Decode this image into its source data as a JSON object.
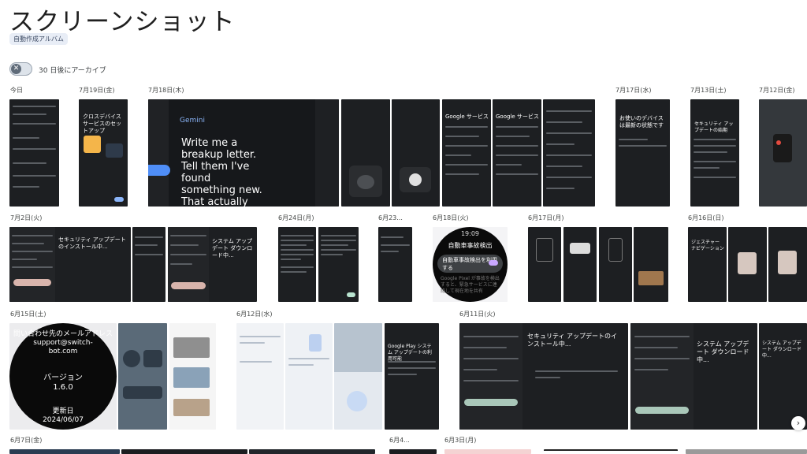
{
  "page": {
    "title": "スクリーンショット",
    "album_chip": "自動作成アルバム",
    "archive_toggle_label": "30 日後にアーカイブ",
    "archive_toggle_state": "off"
  },
  "dates": {
    "d_today": "今日",
    "d_0719": "7月19日(金)",
    "d_0718": "7月18日(木)",
    "d_0717": "7月17日(水)",
    "d_0713": "7月13日(土)",
    "d_0712": "7月12日(金)",
    "d_0702": "7月2日(火)",
    "d_0624": "6月24日(月)",
    "d_0623": "6月23...",
    "d_0618": "6月18日(火)",
    "d_0617": "6月17日(月)",
    "d_0616": "6月16日(日)",
    "d_0615": "6月15日(土)",
    "d_0612": "6月12日(水)",
    "d_0611": "6月11日(火)",
    "d_0607": "6月7日(金)",
    "d_0604": "6月4...",
    "d_0603": "6月3日(月)"
  },
  "tiles": {
    "gemini": {
      "logo": "Gemini",
      "text": "Write me a breakup letter. Tell them I've found something new. That actually feels magical. Not just the same old thing. Oh, and have it start,"
    },
    "cross_device": "クロスデバイス サービスのセットアップ",
    "google_service_1": "Google サービス",
    "google_service_2": "Google サービス",
    "device_latest": "お使いのデバイスは最新の状態です",
    "security_update_july": "セキュリティ アップデートの始期",
    "security_install": "セキュリティ アップデートのインストール中...",
    "system_update_download": "システム アップデート ダウンロード中...",
    "wear": {
      "clock": "19:09",
      "title": "自動車事故検出",
      "pill": "自動車事故検出を利用する",
      "sub": "Google Pixel が事故を検出すると、緊急サービスに連絡して現在地を共有"
    },
    "gesture_nav": "ジェスチャー ナビゲーション",
    "switchbot": {
      "line1": "問い合わせ先のメールアドレス",
      "email": "support@switch-bot.com",
      "version_label": "バージョン",
      "version": "1.6.0",
      "updated_label": "更新日",
      "updated": "2024/06/07"
    },
    "play_system_update": "Google Play システム アップデートの利用可能",
    "security_install_2": "セキュリティ アップデートのインストール中...",
    "system_update_download_2": "システム アップデート ダウンロード中...",
    "system_update_download_3": "システム アップデート ダウンロード中..."
  },
  "icons": {
    "toggle_off": "✕",
    "scroll_next": "›"
  }
}
